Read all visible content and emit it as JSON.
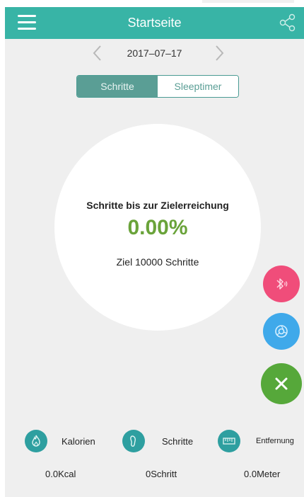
{
  "header": {
    "title": "Startseite"
  },
  "date_nav": {
    "date": "2017–07–17"
  },
  "segments": [
    {
      "label": "Schritte",
      "active": true
    },
    {
      "label": "Sleeptimer",
      "active": false
    }
  ],
  "progress": {
    "title": "Schritte bis zur Zielerreichung",
    "percent_text": "0.00%",
    "goal_text": "Ziel 10000 Schritte",
    "percent_value": 0
  },
  "stats": [
    {
      "label": "Kalorien",
      "value": "0.0Kcal",
      "icon": "flame-icon"
    },
    {
      "label": "Schritte",
      "value": "0Schritt",
      "icon": "footprint-icon"
    },
    {
      "label": "Entfernung",
      "value": "0.0Meter",
      "icon": "ruler-icon"
    }
  ],
  "colors": {
    "header": "#38b4a6",
    "accent": "#5a9e95",
    "percent": "#6aa33a",
    "bluetooth_fab": "#f04d7a",
    "camera_fab": "#3fa9ea",
    "close_fab": "#56a83a",
    "stat_icon": "#2e9fa0"
  }
}
